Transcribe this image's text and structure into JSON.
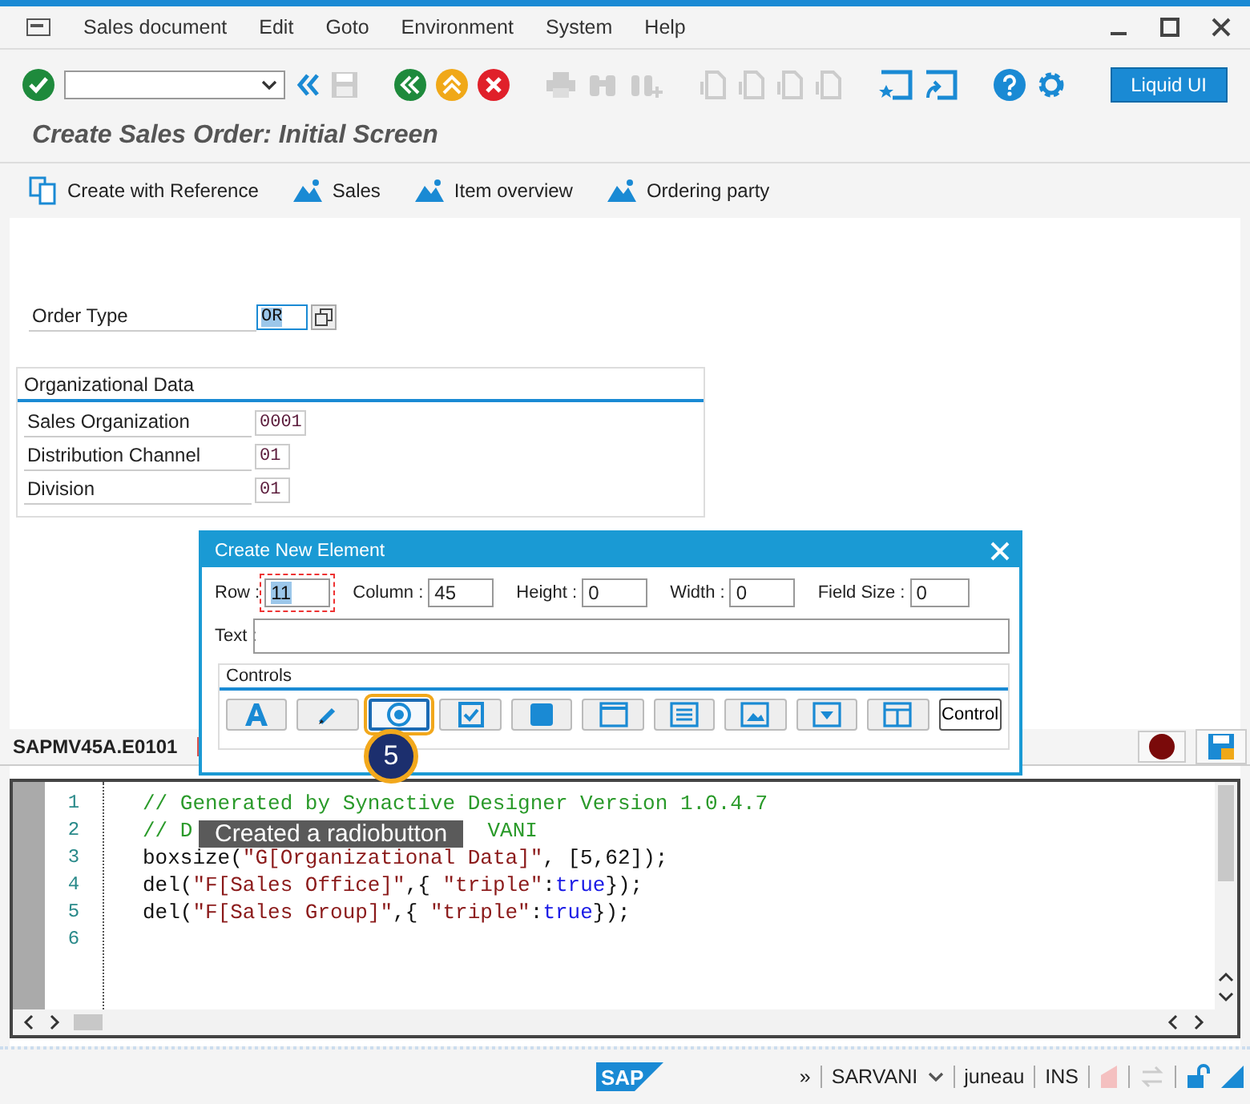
{
  "menu": [
    {
      "label": "Sales document"
    },
    {
      "label": "Edit"
    },
    {
      "label": "Goto"
    },
    {
      "label": "Environment"
    },
    {
      "label": "System"
    },
    {
      "label": "Help"
    }
  ],
  "toolbar": {
    "liquid_button": "Liquid UI"
  },
  "title": "Create Sales Order: Initial Screen",
  "app_toolbar": [
    {
      "kind": "reference",
      "label": "Create with Reference"
    },
    {
      "kind": "mountain",
      "label": "Sales"
    },
    {
      "kind": "mountain",
      "label": "Item overview"
    },
    {
      "kind": "mountain",
      "label": "Ordering party"
    }
  ],
  "order_type": {
    "label": "Order Type",
    "value": "OR"
  },
  "org_data": {
    "title": "Organizational Data",
    "fields": [
      {
        "label": "Sales Organization",
        "value": "0001"
      },
      {
        "label": "Distribution Channel",
        "value": "01"
      },
      {
        "label": "Division",
        "value": "01"
      }
    ]
  },
  "dialog": {
    "title": "Create New Element",
    "fields": [
      {
        "label": "Row :",
        "value": "11",
        "selected": true
      },
      {
        "label": "Column :",
        "value": "45",
        "selected": false
      },
      {
        "label": "Height :",
        "value": "0",
        "selected": false
      },
      {
        "label": "Width :",
        "value": "0",
        "selected": false
      },
      {
        "label": "Field Size :",
        "value": "0",
        "selected": false
      }
    ],
    "text_label": "Text :",
    "controls_title": "Controls",
    "controls": [
      {
        "kind": "text",
        "selected": false
      },
      {
        "kind": "pencil",
        "selected": false
      },
      {
        "kind": "radio",
        "selected": true
      },
      {
        "kind": "checkbox",
        "selected": false
      },
      {
        "kind": "box",
        "selected": false
      },
      {
        "kind": "window",
        "selected": false
      },
      {
        "kind": "list",
        "selected": false
      },
      {
        "kind": "image",
        "selected": false
      },
      {
        "kind": "dropdown",
        "selected": false
      },
      {
        "kind": "table",
        "selected": false
      },
      {
        "kind": "label",
        "label": "Control",
        "selected": false
      }
    ]
  },
  "editor": {
    "tab": "SAPMV45A.E0101",
    "lines": [
      {
        "number": "1",
        "segments": [
          {
            "kind": "comment",
            "text": "// Generated by Synactive Designer Version 1.0.4.7"
          }
        ]
      },
      {
        "number": "2",
        "segments": [
          {
            "kind": "comment",
            "text": "// D"
          },
          {
            "kind": "comment_after_gap",
            "text": "VANI"
          }
        ]
      },
      {
        "number": "3",
        "segments": [
          {
            "kind": "plain",
            "text": "boxsize("
          },
          {
            "kind": "string",
            "text": "\"G[Organizational Data]\""
          },
          {
            "kind": "plain",
            "text": ", [5,62]);"
          }
        ]
      },
      {
        "number": "4",
        "segments": [
          {
            "kind": "plain",
            "text": "del("
          },
          {
            "kind": "string",
            "text": "\"F[Sales Office]\""
          },
          {
            "kind": "plain",
            "text": ",{ "
          },
          {
            "kind": "string",
            "text": "\"triple\""
          },
          {
            "kind": "plain",
            "text": ":"
          },
          {
            "kind": "keyword",
            "text": "true"
          },
          {
            "kind": "plain",
            "text": "});"
          }
        ]
      },
      {
        "number": "5",
        "segments": [
          {
            "kind": "plain",
            "text": "del("
          },
          {
            "kind": "string",
            "text": "\"F[Sales Group]\""
          },
          {
            "kind": "plain",
            "text": ",{ "
          },
          {
            "kind": "string",
            "text": "\"triple\""
          },
          {
            "kind": "plain",
            "text": ":"
          },
          {
            "kind": "keyword",
            "text": "true"
          },
          {
            "kind": "plain",
            "text": "});"
          }
        ]
      },
      {
        "number": "6"
      }
    ]
  },
  "callout": {
    "step": "5",
    "text": "Created a radiobutton"
  },
  "status_bar": {
    "logo": "SAP",
    "expand": "»",
    "user": "SARVANI",
    "server": "juneau",
    "mode": "INS"
  }
}
